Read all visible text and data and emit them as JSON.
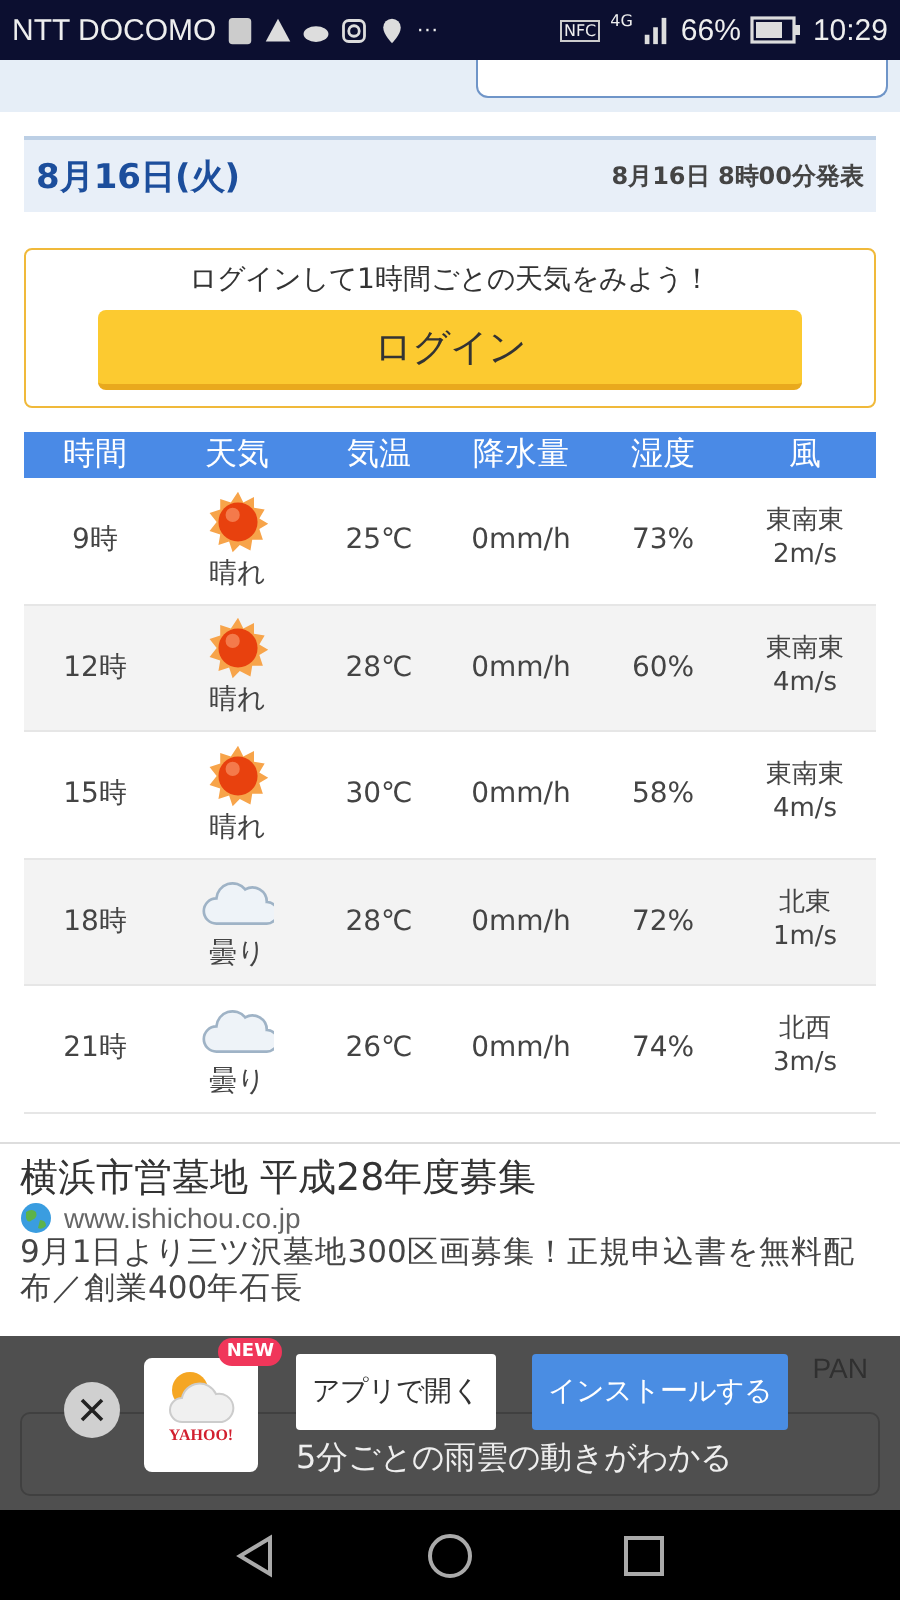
{
  "status_bar": {
    "carrier": "NTT DOCOMO",
    "more": "···",
    "nfc": "NFC",
    "network": "4G",
    "battery": "66%",
    "time": "10:29"
  },
  "date_bar": {
    "date": "8月16日(火)",
    "published": "8月16日 8時00分発表"
  },
  "login_prompt": {
    "message": "ログインして1時間ごとの天気をみよう！",
    "button": "ログイン"
  },
  "forecast": {
    "columns": [
      "時間",
      "天気",
      "気温",
      "降水量",
      "湿度",
      "風"
    ],
    "rows": [
      {
        "time": "9時",
        "kind": "sunny",
        "weather": "晴れ",
        "temp": "25℃",
        "precip": "0mm/h",
        "humidity": "73%",
        "wind_dir": "東南東",
        "wind_speed": "2m/s"
      },
      {
        "time": "12時",
        "kind": "sunny",
        "weather": "晴れ",
        "temp": "28℃",
        "precip": "0mm/h",
        "humidity": "60%",
        "wind_dir": "東南東",
        "wind_speed": "4m/s"
      },
      {
        "time": "15時",
        "kind": "sunny",
        "weather": "晴れ",
        "temp": "30℃",
        "precip": "0mm/h",
        "humidity": "58%",
        "wind_dir": "東南東",
        "wind_speed": "4m/s"
      },
      {
        "time": "18時",
        "kind": "cloudy",
        "weather": "曇り",
        "temp": "28℃",
        "precip": "0mm/h",
        "humidity": "72%",
        "wind_dir": "北東",
        "wind_speed": "1m/s"
      },
      {
        "time": "21時",
        "kind": "cloudy",
        "weather": "曇り",
        "temp": "26℃",
        "precip": "0mm/h",
        "humidity": "74%",
        "wind_dir": "北西",
        "wind_speed": "3m/s"
      }
    ]
  },
  "ad": {
    "title": "横浜市営墓地 平成28年度募集",
    "url": "www.ishichou.co.jp",
    "description": "9月1日より三ツ沢墓地300区画募集！正規申込書を無料配布／創業400年石長"
  },
  "behind_banner": {
    "partial_text": "PAN"
  },
  "app_banner": {
    "badge": "NEW",
    "logo_text": "YAHOO!",
    "open_button": "アプリで開く",
    "install_button": "インストールする",
    "tagline": "5分ごとの雨雲の動きがわかる"
  }
}
